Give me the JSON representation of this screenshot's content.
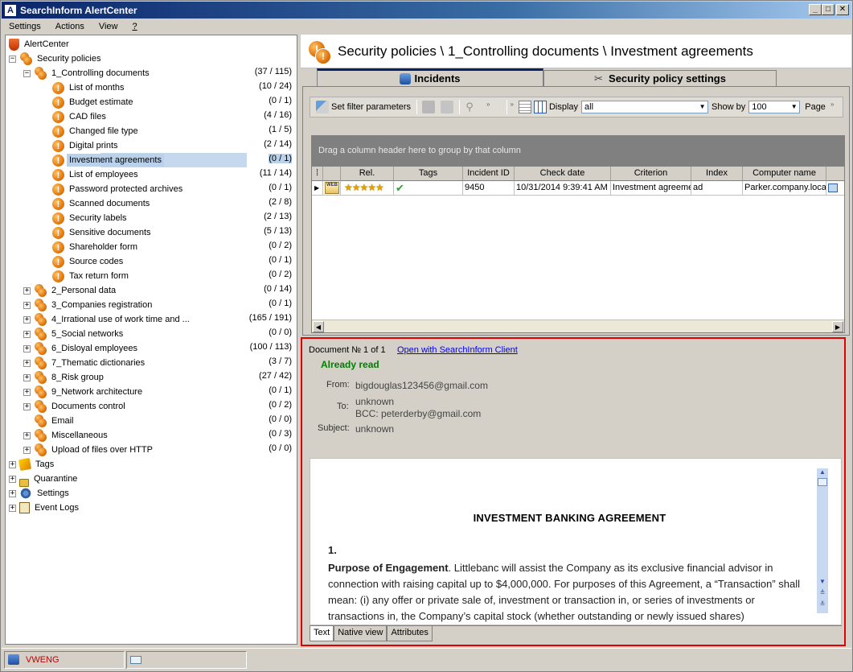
{
  "window": {
    "title": "SearchInform AlertCenter",
    "buttons": {
      "min": "_",
      "max": "□",
      "close": "✕"
    }
  },
  "menu": [
    "Settings",
    "Actions",
    "View",
    "?"
  ],
  "tree": {
    "root": "AlertCenter",
    "security_policies": "Security policies",
    "controlling": {
      "label": "1_Controlling documents",
      "count": "(37 / 115)"
    },
    "children": [
      {
        "label": "List of months",
        "count": "(10 / 24)"
      },
      {
        "label": "Budget estimate",
        "count": "(0 / 1)"
      },
      {
        "label": "CAD files",
        "count": "(4 / 16)"
      },
      {
        "label": "Changed file type",
        "count": "(1 / 5)"
      },
      {
        "label": "Digital prints",
        "count": "(2 / 14)"
      },
      {
        "label": "Investment agreements",
        "count": "(0 / 1)"
      },
      {
        "label": "List of employees",
        "count": "(11 / 14)"
      },
      {
        "label": "Password protected archives",
        "count": "(0 / 1)"
      },
      {
        "label": "Scanned documents",
        "count": "(2 / 8)"
      },
      {
        "label": "Security labels",
        "count": "(2 / 13)"
      },
      {
        "label": "Sensitive documents",
        "count": "(5 / 13)"
      },
      {
        "label": "Shareholder form",
        "count": "(0 / 2)"
      },
      {
        "label": "Source codes",
        "count": "(0 / 1)"
      },
      {
        "label": "Tax return form",
        "count": "(0 / 2)"
      }
    ],
    "groups": [
      {
        "label": "2_Personal data",
        "count": "(0 / 14)"
      },
      {
        "label": "3_Companies registration",
        "count": "(0 / 1)"
      },
      {
        "label": "4_Irrational use of work time and ...",
        "count": "(165 / 191)"
      },
      {
        "label": "5_Social networks",
        "count": "(0 / 0)"
      },
      {
        "label": "6_Disloyal employees",
        "count": "(100 / 113)"
      },
      {
        "label": "7_Thematic dictionaries",
        "count": "(3 / 7)"
      },
      {
        "label": "8_Risk group",
        "count": "(27 / 42)"
      },
      {
        "label": "9_Network architecture",
        "count": "(0 / 1)"
      },
      {
        "label": "Documents control",
        "count": "(0 / 2)"
      },
      {
        "label": "Email",
        "count": "(0 / 0)"
      },
      {
        "label": "Miscellaneous",
        "count": "(0 / 3)"
      },
      {
        "label": "Upload of files over HTTP",
        "count": "(0 / 0)"
      }
    ],
    "bottom": [
      "Tags",
      "Quarantine",
      "Settings",
      "Event Logs"
    ]
  },
  "header": {
    "title": "Security policies \\ 1_Controlling documents \\ Investment agreements"
  },
  "tabs": {
    "incidents": "Incidents",
    "policy_settings": "Security policy settings"
  },
  "toolbar": {
    "filter": "Set filter parameters",
    "display_label": "Display",
    "display_value": "all",
    "showby_label": "Show by",
    "showby_value": "100",
    "page_label": "Page"
  },
  "grid": {
    "group_hint": "Drag a column header here to group by that column",
    "columns": [
      "Rel.",
      "Tags",
      "Incident ID",
      "Check date",
      "Criterion",
      "Index",
      "Computer name"
    ],
    "row": {
      "type": "WEB",
      "id": "9450",
      "date": "10/31/2014 9:39:41 AM",
      "criterion": "Investment agreeme",
      "index": "ad",
      "computer": "Parker.company.loca"
    },
    "rating": 5
  },
  "document": {
    "counter": "Document № 1 of 1",
    "open_link": "Open with SearchInform Client",
    "status": "Already read",
    "from_label": "From:",
    "from": "bigdouglas123456@gmail.com",
    "to_label": "To:",
    "to": "unknown",
    "bcc": "BCC: peterderby@gmail.com",
    "subject_label": "Subject:",
    "subject": "unknown",
    "page_title": "INVESTMENT BANKING AGREEMENT",
    "section_num": "1.",
    "section_head": "Purpose of Engagement",
    "section_text": ".  Littlebanc will assist the Company as its exclusive financial advisor in connection with raising capital up to $4,000,000. For purposes of this Agreement, a “Transaction” shall mean: (i) any offer or private sale of, investment or transaction in, or series of investments or transactions in, the Company’s capital stock (whether outstanding or newly issued shares)",
    "tabs": [
      "Text",
      "Native view",
      "Attributes"
    ]
  },
  "status": {
    "user": "VWENG"
  }
}
